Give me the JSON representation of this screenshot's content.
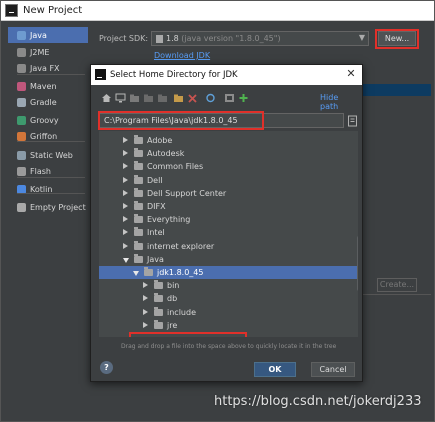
{
  "window": {
    "title": "New Project"
  },
  "project_types": [
    {
      "label": "Java",
      "icon": "folder-icon",
      "color": "#6e9bd0",
      "selected": true
    },
    {
      "label": "J2ME",
      "icon": "j2me-icon",
      "color": "#8a8a8a"
    },
    {
      "label": "Java FX",
      "icon": "javafx-icon",
      "color": "#8a8a8a"
    },
    {
      "label": "Maven",
      "icon": "maven-icon",
      "color": "#c0577c"
    },
    {
      "label": "Gradle",
      "icon": "gradle-icon",
      "color": "#9aa7b3"
    },
    {
      "label": "Groovy",
      "icon": "groovy-icon",
      "color": "#3e9a6e"
    },
    {
      "label": "Griffon",
      "icon": "griffon-icon",
      "color": "#d2763a"
    },
    {
      "label": "Static Web",
      "icon": "globe-icon",
      "color": "#8a9ba8"
    },
    {
      "label": "Flash",
      "icon": "flash-icon",
      "color": "#9a9a9a"
    },
    {
      "label": "Kotlin",
      "icon": "kotlin-icon",
      "color": "#4c88e0"
    },
    {
      "label": "Empty Project",
      "icon": "folder-icon",
      "color": "#a9a9a9"
    }
  ],
  "sdk": {
    "label": "Project SDK:",
    "value": "1.8",
    "detail": "(java version \"1.8.0_45\")",
    "new_button": "New...",
    "download_link": "Download JDK"
  },
  "create_button": "Create...",
  "dialog": {
    "title": "Select Home Directory for JDK",
    "hide_path": "Hide path",
    "path": "C:\\Program Files\\Java\\jdk1.8.0_45",
    "hint": "Drag and drop a file into the space above to quickly locate it in the tree",
    "ok": "OK",
    "cancel": "Cancel",
    "help": "?"
  },
  "tree": [
    {
      "label": "Adobe",
      "depth": 0
    },
    {
      "label": "Autodesk",
      "depth": 0
    },
    {
      "label": "Common Files",
      "depth": 0
    },
    {
      "label": "Dell",
      "depth": 0
    },
    {
      "label": "Dell Support Center",
      "depth": 0
    },
    {
      "label": "DIFX",
      "depth": 0
    },
    {
      "label": "Everything",
      "depth": 0
    },
    {
      "label": "Intel",
      "depth": 0
    },
    {
      "label": "internet explorer",
      "depth": 0
    },
    {
      "label": "Java",
      "depth": 0,
      "expanded": true
    },
    {
      "label": "jdk1.8.0_45",
      "depth": 1,
      "expanded": true,
      "selected": true
    },
    {
      "label": "bin",
      "depth": 2
    },
    {
      "label": "db",
      "depth": 2
    },
    {
      "label": "include",
      "depth": 2
    },
    {
      "label": "jre",
      "depth": 2
    }
  ],
  "watermark": "https://blog.csdn.net/jokerdj233"
}
